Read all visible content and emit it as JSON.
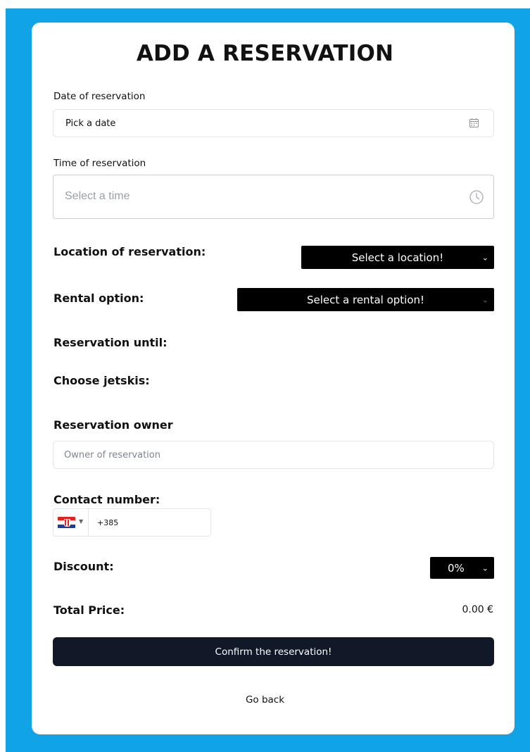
{
  "form": {
    "title": "ADD A RESERVATION",
    "date": {
      "label": "Date of reservation",
      "placeholder": "Pick a date"
    },
    "time": {
      "label": "Time of reservation",
      "placeholder": "Select a time"
    },
    "location": {
      "label": "Location of reservation:",
      "selected": "Select a location!"
    },
    "rental": {
      "label": "Rental option:",
      "selected": "Select a rental option!"
    },
    "until": {
      "label": "Reservation until:"
    },
    "jetskis": {
      "label": "Choose jetskis:"
    },
    "owner": {
      "label": "Reservation owner",
      "placeholder": "Owner of reservation"
    },
    "contact": {
      "label": "Contact number:",
      "value": "+385",
      "country_flag": "croatia-flag"
    },
    "discount": {
      "label": "Discount:",
      "selected": "0%"
    },
    "total": {
      "label": "Total Price:",
      "value": "0.00 €"
    },
    "confirm_label": "Confirm the reservation!",
    "back_label": "Go back"
  },
  "colors": {
    "background": "#10a3e6",
    "card": "#ffffff",
    "select_bg": "#000000",
    "confirm_bg": "#111827"
  }
}
